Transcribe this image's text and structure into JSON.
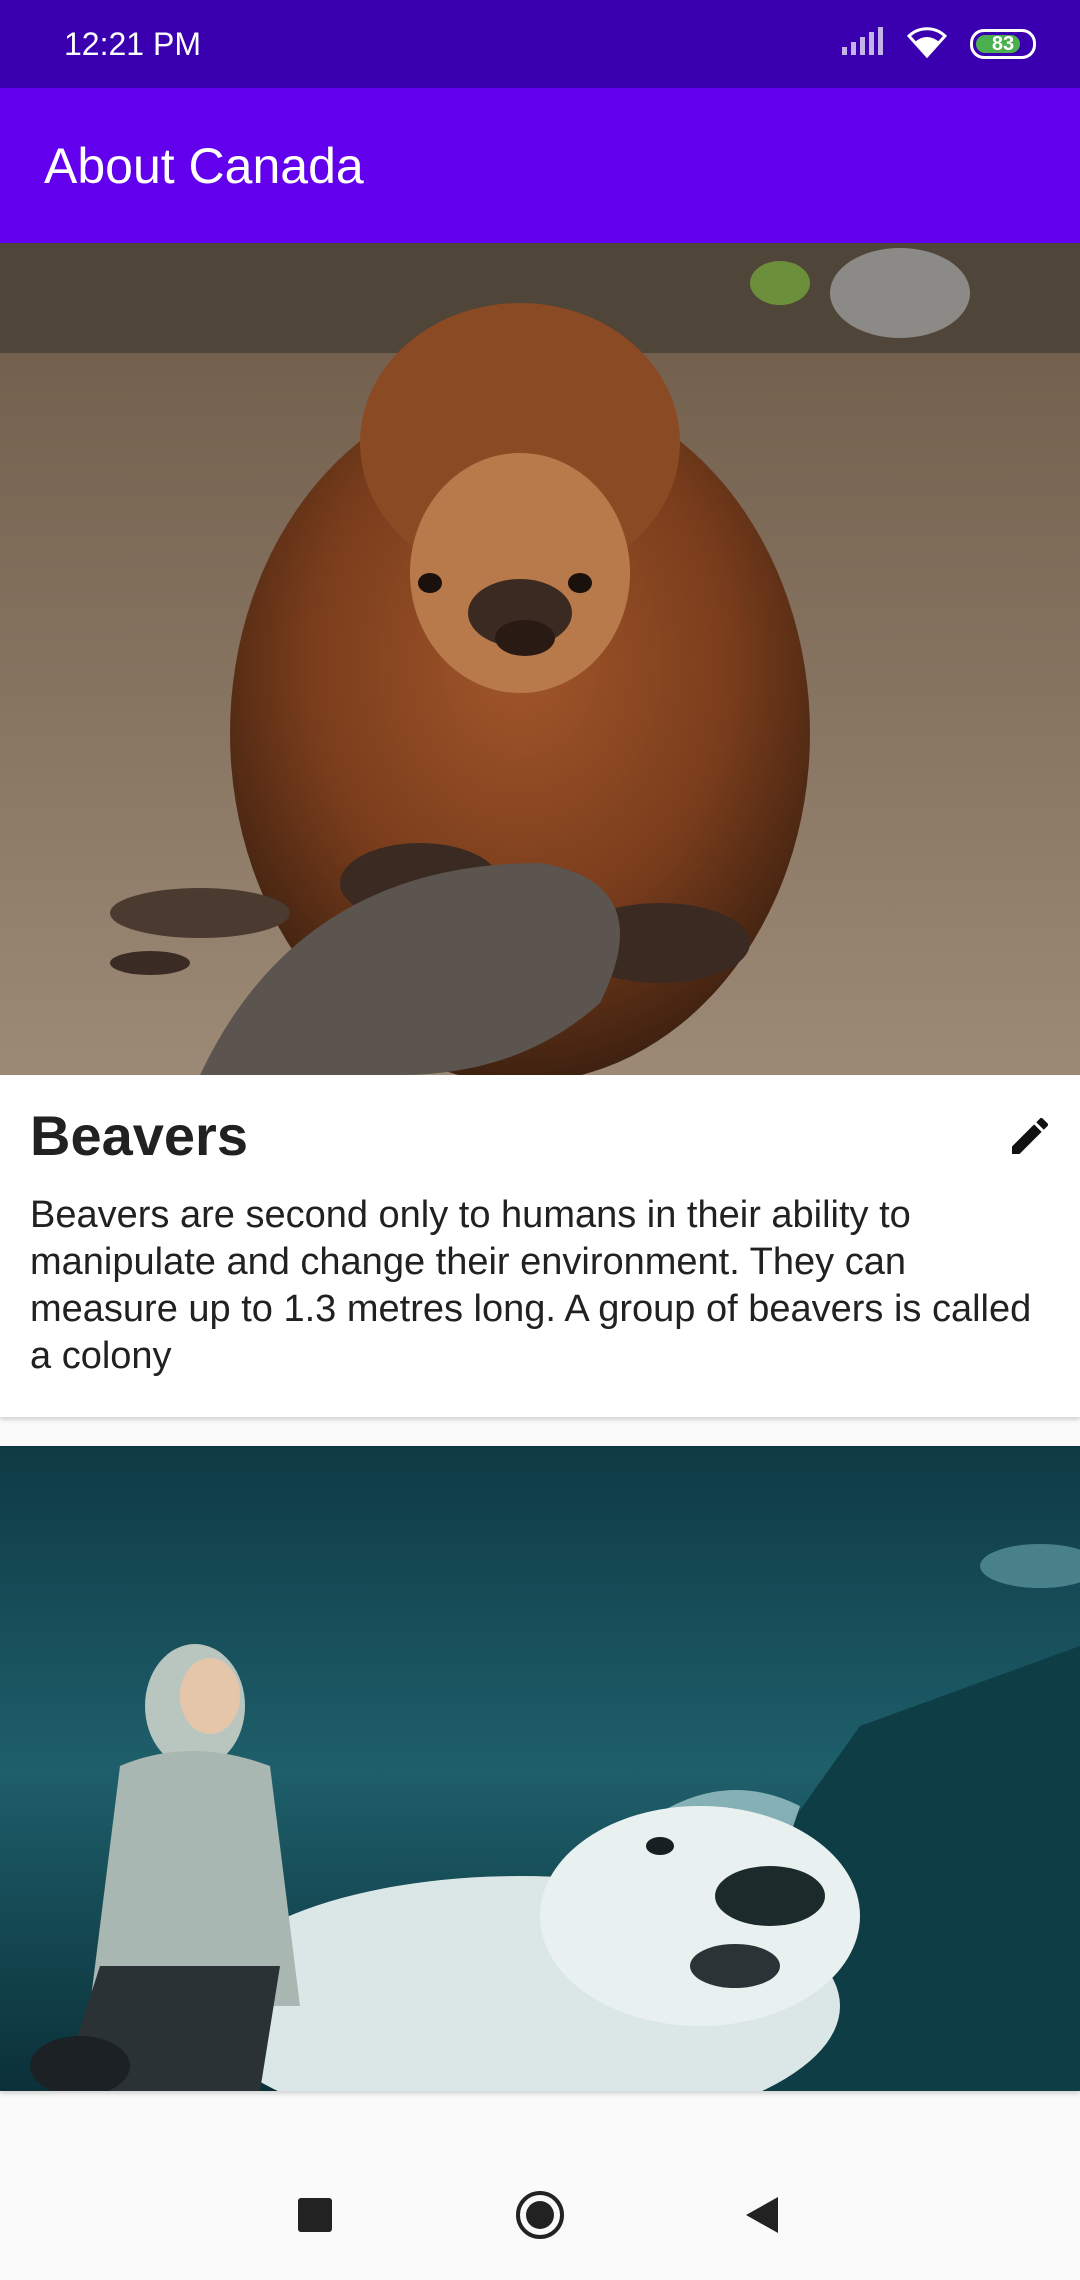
{
  "status_bar": {
    "time": "12:21 PM",
    "battery": "83",
    "battery_level": 0.83,
    "icons": [
      "signal-icon",
      "wifi-icon",
      "battery-icon"
    ]
  },
  "app_bar": {
    "title": "About Canada",
    "color": "#6200ee"
  },
  "cards": [
    {
      "title": "Beavers",
      "description": "Beavers are second only to humans in their ability to manipulate and change their environment. They can measure up to 1.3 metres long. A group of beavers is called a colony",
      "image": "beaver-photo",
      "action_icon": "edit-icon"
    },
    {
      "image": "girl-riding-polar-bear-photo"
    }
  ],
  "nav_bar": {
    "buttons": [
      "recents-icon",
      "home-icon",
      "back-icon"
    ]
  }
}
